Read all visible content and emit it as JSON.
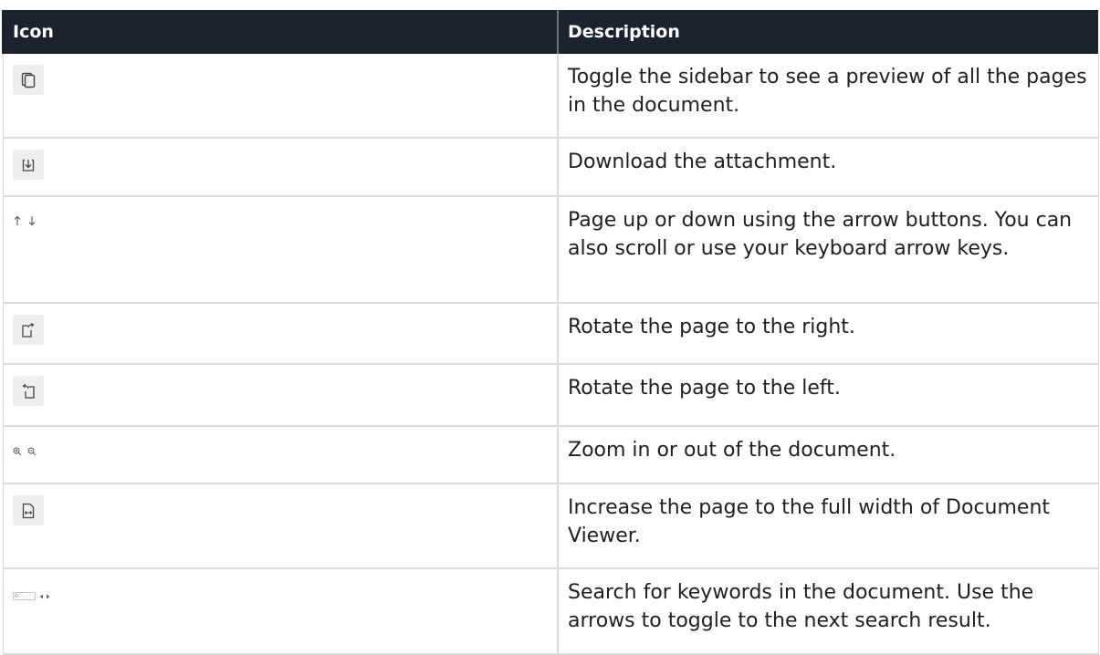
{
  "table": {
    "headers": {
      "icon": "Icon",
      "description": "Description"
    },
    "rows": [
      {
        "icon": "sidebar-toggle-icon",
        "description": "Toggle the sidebar to see a preview of all the pages in the document."
      },
      {
        "icon": "download-icon",
        "description": "Download the attachment."
      },
      {
        "icon": "page-up-down-arrows-icon",
        "description": "Page up or down using the arrow buttons. You can also scroll or use your keyboard arrow keys."
      },
      {
        "icon": "rotate-right-icon",
        "description": "Rotate the page to the right."
      },
      {
        "icon": "rotate-left-icon",
        "description": "Rotate the page to the left."
      },
      {
        "icon": "zoom-in-out-icon",
        "description": "Zoom in or out of the document."
      },
      {
        "icon": "fit-width-icon",
        "description": "Increase the page to the full width of Document Viewer."
      },
      {
        "icon": "search-bar-icon",
        "description": "Search for keywords in the document. Use the arrows to toggle to the next search result."
      }
    ]
  },
  "colors": {
    "header_bg": "#1b2230",
    "header_text": "#ffffff",
    "icon_bg": "#eeeeee",
    "border": "#dcdcdc"
  }
}
